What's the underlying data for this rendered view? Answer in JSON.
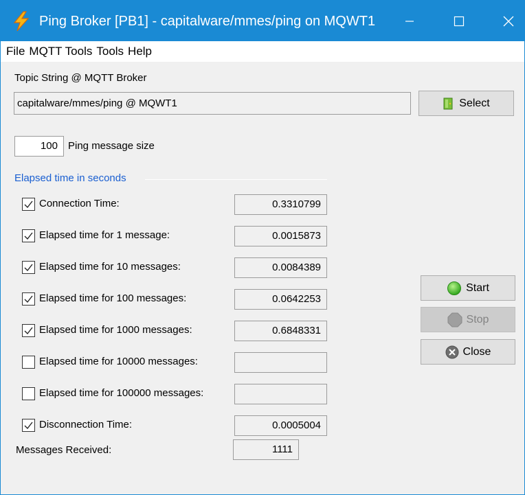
{
  "window": {
    "title": "Ping Broker [PB1] - capitalware/mmes/ping on MQWT1",
    "accent": "#1a8ad4"
  },
  "menu": [
    "File",
    "MQTT Tools",
    "Tools",
    "Help"
  ],
  "topic": {
    "label": "Topic String @ MQTT Broker",
    "value": "capitalware/mmes/ping @ MQWT1",
    "select_label": "Select"
  },
  "ping_size": {
    "value": "100",
    "label": "Ping message size"
  },
  "elapsed": {
    "group_label": "Elapsed time in seconds",
    "rows": [
      {
        "label": "Connection Time:",
        "checked": true,
        "value": "0.3310799"
      },
      {
        "label": "Elapsed time for 1 message:",
        "checked": true,
        "value": "0.0015873"
      },
      {
        "label": "Elapsed time for 10 messages:",
        "checked": true,
        "value": "0.0084389"
      },
      {
        "label": "Elapsed time for 100 messages:",
        "checked": true,
        "value": "0.0642253"
      },
      {
        "label": "Elapsed time for 1000 messages:",
        "checked": true,
        "value": "0.6848331"
      },
      {
        "label": "Elapsed time for 10000 messages:",
        "checked": false,
        "value": ""
      },
      {
        "label": "Elapsed time for 100000 messages:",
        "checked": false,
        "value": ""
      },
      {
        "label": "Disconnection Time:",
        "checked": true,
        "value": "0.0005004"
      }
    ]
  },
  "received": {
    "label": "Messages Received:",
    "value": "1111"
  },
  "buttons": {
    "start": "Start",
    "stop": "Stop",
    "close": "Close"
  },
  "icons": {
    "app": "lightning-bolt-icon",
    "select": "door-icon",
    "start": "green-circle-icon",
    "stop": "grey-octagon-icon",
    "close": "close-x-circle-icon"
  }
}
